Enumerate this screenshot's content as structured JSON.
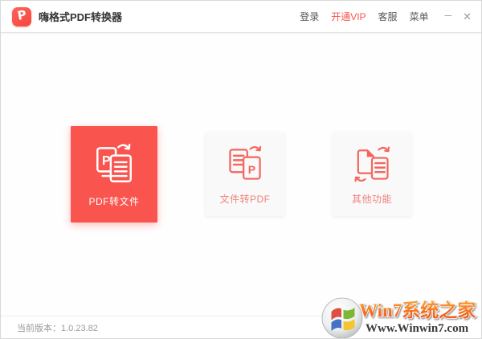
{
  "colors": {
    "brand_red": "#fa544e",
    "card_label_red": "#f0837d",
    "nav_text": "#595959",
    "vip_red": "#f8534e",
    "version_text": "#9a9a9a",
    "watermark_orange": "#f4731f"
  },
  "titlebar": {
    "logo_glyph": "P",
    "app_title": "嗨格式PDF转换器",
    "nav": [
      {
        "label": "登录",
        "highlight": false
      },
      {
        "label": "开通VIP",
        "highlight": true
      },
      {
        "label": "客服",
        "highlight": false
      },
      {
        "label": "菜单",
        "highlight": false
      }
    ],
    "minimize_glyph": "─",
    "close_glyph": "✕"
  },
  "cards": [
    {
      "label": "PDF转文件",
      "icon": "pdf-to-file-icon",
      "icon_letter": "P",
      "active": true
    },
    {
      "label": "文件转PDF",
      "icon": "file-to-pdf-icon",
      "icon_letter": "P",
      "active": false
    },
    {
      "label": "其他功能",
      "icon": "other-functions-icon",
      "active": false
    }
  ],
  "footer": {
    "version": "当前版本：1.0.23.82"
  },
  "watermark": {
    "icon": "windows-flag-icon",
    "site_name": "Win7系统之家",
    "site_url": "Www.Winwin7.com"
  }
}
